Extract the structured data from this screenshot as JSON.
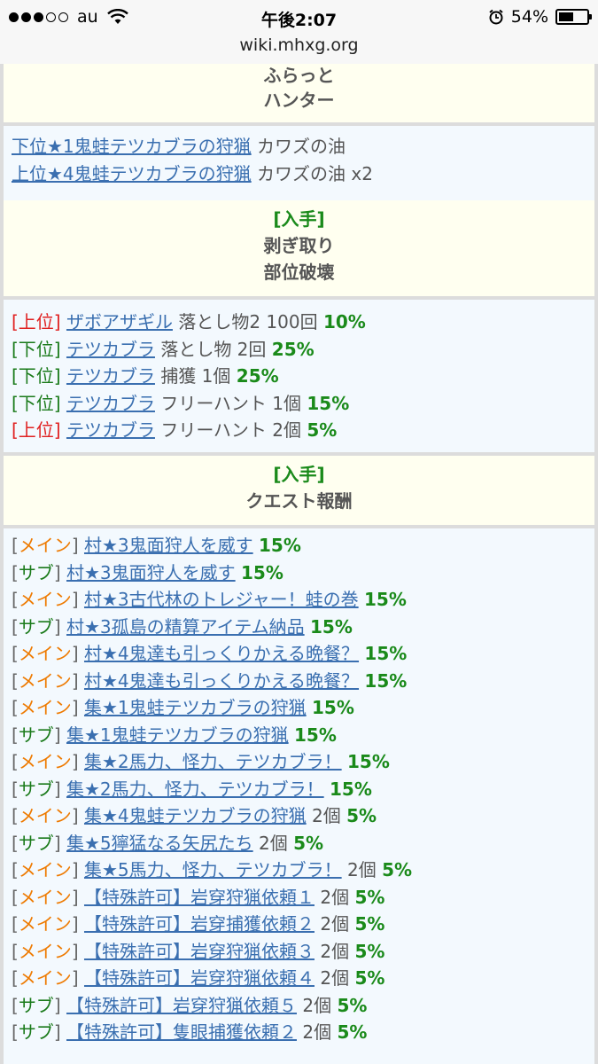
{
  "status": {
    "carrier": "au",
    "time": "午後2:07",
    "battery": "54%",
    "battery_level": 0.54
  },
  "url": "wiki.mhxg.org",
  "header1": [
    "ふらっと",
    "ハンター"
  ],
  "body1": [
    {
      "link": "下位★1鬼蛙テツカブラの狩猟",
      "text": "カワズの油"
    },
    {
      "link": "上位★4鬼蛙テツカブラの狩猟",
      "text": "カワズの油 x2"
    }
  ],
  "header2": {
    "tag": "[入手]",
    "lines": [
      "剥ぎ取り",
      "部位破壊"
    ]
  },
  "body2": [
    {
      "rank": "上位",
      "rank_color": "red",
      "link": "ザボアザギル",
      "text": "落とし物2 100回",
      "pct": "10%"
    },
    {
      "rank": "下位",
      "rank_color": "green",
      "link": "テツカブラ",
      "text": "落とし物 2回",
      "pct": "25%"
    },
    {
      "rank": "下位",
      "rank_color": "green",
      "link": "テツカブラ",
      "text": "捕獲 1個",
      "pct": "25%"
    },
    {
      "rank": "下位",
      "rank_color": "green",
      "link": "テツカブラ",
      "text": "フリーハント 1個",
      "pct": "15%"
    },
    {
      "rank": "上位",
      "rank_color": "red",
      "link": "テツカブラ",
      "text": "フリーハント 2個",
      "pct": "5%"
    }
  ],
  "header3": {
    "tag": "[入手]",
    "lines": [
      "クエスト報酬"
    ]
  },
  "body3": [
    {
      "type": "メイン",
      "link": "村★3鬼面狩人を威す",
      "text": "",
      "pct": "15%"
    },
    {
      "type": "サブ",
      "link": "村★3鬼面狩人を威す",
      "text": "",
      "pct": "15%"
    },
    {
      "type": "メイン",
      "link": "村★3古代林のトレジャー！蛙の巻",
      "text": "",
      "pct": "15%"
    },
    {
      "type": "サブ",
      "link": "村★3孤島の精算アイテム納品",
      "text": "",
      "pct": "15%"
    },
    {
      "type": "メイン",
      "link": "村★4鬼達も引っくりかえる晩餐？",
      "text": "",
      "pct": "15%"
    },
    {
      "type": "メイン",
      "link": "村★4鬼達も引っくりかえる晩餐？",
      "text": "",
      "pct": "15%"
    },
    {
      "type": "メイン",
      "link": "集★1鬼蛙テツカブラの狩猟",
      "text": "",
      "pct": "15%"
    },
    {
      "type": "サブ",
      "link": "集★1鬼蛙テツカブラの狩猟",
      "text": "",
      "pct": "15%"
    },
    {
      "type": "メイン",
      "link": "集★2馬力、怪力、テツカブラ！",
      "text": "",
      "pct": "15%"
    },
    {
      "type": "サブ",
      "link": "集★2馬力、怪力、テツカブラ！",
      "text": "",
      "pct": "15%"
    },
    {
      "type": "メイン",
      "link": "集★4鬼蛙テツカブラの狩猟",
      "text": "2個",
      "pct": "5%"
    },
    {
      "type": "サブ",
      "link": "集★5獰猛なる矢尻たち",
      "text": "2個",
      "pct": "5%"
    },
    {
      "type": "メイン",
      "link": "集★5馬力、怪力、テツカブラ！",
      "text": "2個",
      "pct": "5%"
    },
    {
      "type": "メイン",
      "link": "【特殊許可】岩穿狩猟依頼１",
      "text": "2個",
      "pct": "5%"
    },
    {
      "type": "メイン",
      "link": "【特殊許可】岩穿捕獲依頼２",
      "text": "2個",
      "pct": "5%"
    },
    {
      "type": "メイン",
      "link": "【特殊許可】岩穿狩猟依頼３",
      "text": "2個",
      "pct": "5%"
    },
    {
      "type": "メイン",
      "link": "【特殊許可】岩穿狩猟依頼４",
      "text": "2個",
      "pct": "5%"
    },
    {
      "type": "サブ",
      "link": "【特殊許可】岩穿狩猟依頼５",
      "text": "2個",
      "pct": "5%"
    },
    {
      "type": "サブ",
      "link": "【特殊許可】隻眼捕獲依頼２",
      "text": "2個",
      "pct": "5%"
    }
  ]
}
